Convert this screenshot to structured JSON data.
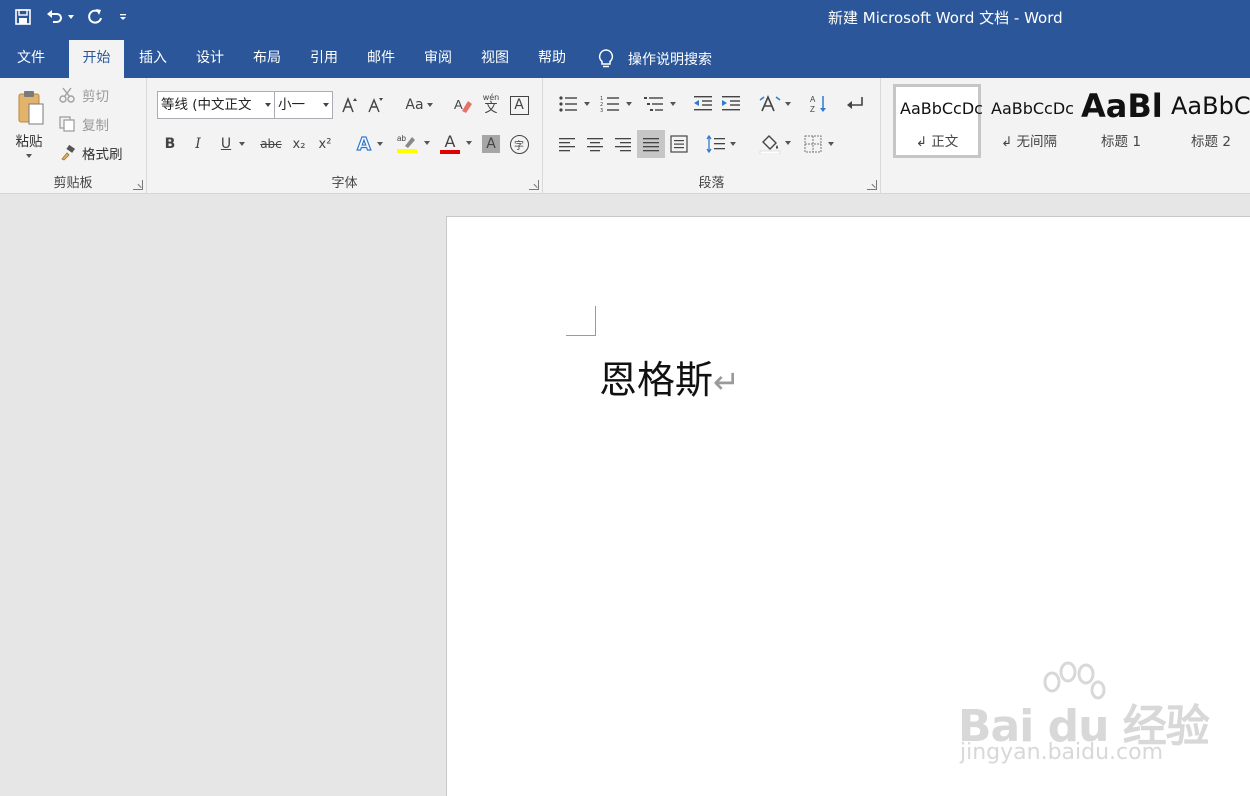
{
  "window": {
    "title": "新建 Microsoft Word 文档  -  Word"
  },
  "tabs": [
    {
      "label": "文件"
    },
    {
      "label": "开始"
    },
    {
      "label": "插入"
    },
    {
      "label": "设计"
    },
    {
      "label": "布局"
    },
    {
      "label": "引用"
    },
    {
      "label": "邮件"
    },
    {
      "label": "审阅"
    },
    {
      "label": "视图"
    },
    {
      "label": "帮助"
    }
  ],
  "active_tab": "开始",
  "tell_me": {
    "label": "操作说明搜索"
  },
  "clipboard": {
    "group_label": "剪贴板",
    "paste_label": "粘贴",
    "cut_label": "剪切",
    "copy_label": "复制",
    "format_painter_label": "格式刷"
  },
  "font": {
    "group_label": "字体",
    "font_name": "等线 (中文正文",
    "font_size": "小一",
    "change_case_label": "Aa",
    "phonetic_label": "wén",
    "bold": "B",
    "italic": "I",
    "underline": "U",
    "strikethrough": "abc",
    "subscript": "x₂",
    "superscript": "x²",
    "text_effects": "A",
    "font_color": "A",
    "char_shading": "A",
    "enclose": "字",
    "highlight_color": "#ffff00",
    "font_color_value": "#e00000"
  },
  "paragraph": {
    "group_label": "段落"
  },
  "styles": {
    "items": [
      {
        "preview": "AaBbCcDc",
        "name": "↲ 正文",
        "selected": true
      },
      {
        "preview": "AaBbCcDc",
        "name": "↲ 无间隔",
        "selected": false
      },
      {
        "preview": "AaBl",
        "name": "标题 1",
        "selected": false
      },
      {
        "preview": "AaBbC",
        "name": "标题 2",
        "selected": false
      }
    ]
  },
  "document": {
    "text": "恩格斯",
    "paragraph_mark": "↵"
  },
  "watermark": {
    "main": "Bai du 经验",
    "url": "jingyan.baidu.com"
  }
}
